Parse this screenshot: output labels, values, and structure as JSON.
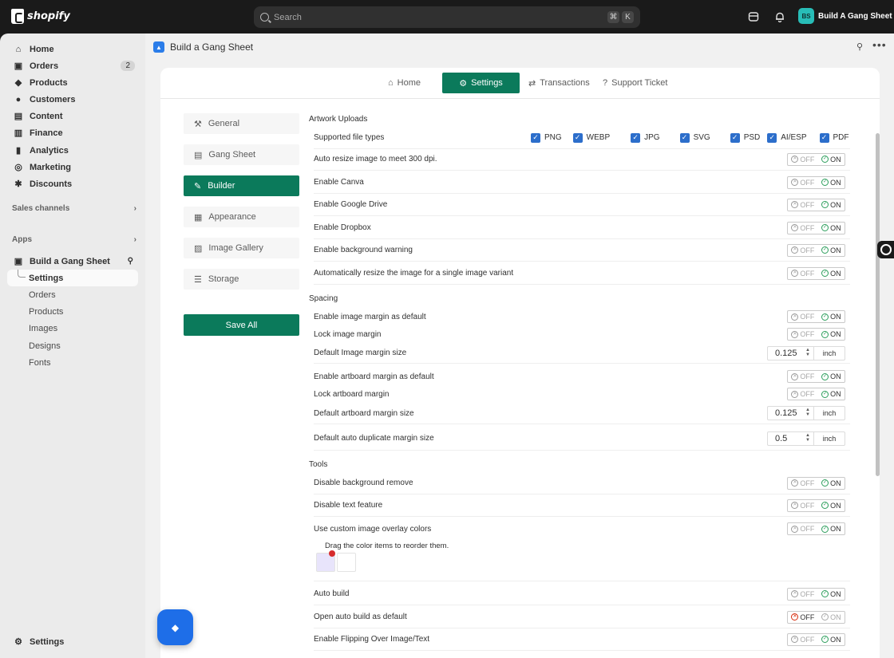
{
  "topbar": {
    "logo_text": "shopify",
    "search_placeholder": "Search",
    "kbd_cmd": "⌘",
    "kbd_k": "K",
    "store_initials": "BS",
    "store_name": "Build A Gang Sheet"
  },
  "nav": {
    "items": [
      {
        "label": "Home",
        "icon": "home-icon"
      },
      {
        "label": "Orders",
        "icon": "orders-icon",
        "badge": "2"
      },
      {
        "label": "Products",
        "icon": "tag-icon"
      },
      {
        "label": "Customers",
        "icon": "person-icon"
      },
      {
        "label": "Content",
        "icon": "content-icon"
      },
      {
        "label": "Finance",
        "icon": "bank-icon"
      },
      {
        "label": "Analytics",
        "icon": "chart-icon"
      },
      {
        "label": "Marketing",
        "icon": "target-icon"
      },
      {
        "label": "Discounts",
        "icon": "discount-icon"
      }
    ],
    "sales_channels": "Sales channels",
    "apps": "Apps",
    "app_name": "Build a Gang Sheet",
    "app_sub": [
      "Settings",
      "Orders",
      "Products",
      "Images",
      "Designs",
      "Fonts"
    ],
    "bottom_settings": "Settings"
  },
  "main": {
    "app_title": "Build a Gang Sheet",
    "tabs": [
      "Home",
      "Settings",
      "Transactions",
      "Support Ticket"
    ],
    "side_tabs": [
      "General",
      "Gang Sheet",
      "Builder",
      "Appearance",
      "Image Gallery",
      "Storage"
    ],
    "save_all": "Save All"
  },
  "toggle": {
    "off": "OFF",
    "on": "ON"
  },
  "settings": {
    "artwork_title": "Artwork Uploads",
    "supported_label": "Supported file types",
    "file_types": [
      "PNG",
      "WEBP",
      "JPG",
      "SVG",
      "PSD",
      "AI/ESP",
      "PDF"
    ],
    "artwork_rows": [
      "Auto resize image to meet 300 dpi.",
      "Enable Canva",
      "Enable Google Drive",
      "Enable Dropbox",
      "Enable background warning",
      "Automatically resize the image for a single image variant"
    ],
    "spacing_title": "Spacing",
    "spacing": {
      "img_margin_default": "Enable image margin as default",
      "lock_img_margin": "Lock image margin",
      "default_img_margin": "Default Image margin size",
      "default_img_margin_val": "0.125",
      "artboard_default": "Enable artboard margin as default",
      "lock_artboard": "Lock artboard margin",
      "default_artboard": "Default artboard margin size",
      "default_artboard_val": "0.125",
      "auto_dup": "Default auto duplicate margin size",
      "auto_dup_val": "0.5",
      "unit": "inch"
    },
    "tools_title": "Tools",
    "tools": {
      "bg_remove": "Disable background remove",
      "text_feature": "Disable text feature",
      "overlay": "Use custom image overlay colors",
      "drag_hint": "Drag the color items to reorder them.",
      "auto_build": "Auto build",
      "open_auto_build": "Open auto build as default",
      "flipping": "Enable Flipping Over Image/Text"
    }
  }
}
